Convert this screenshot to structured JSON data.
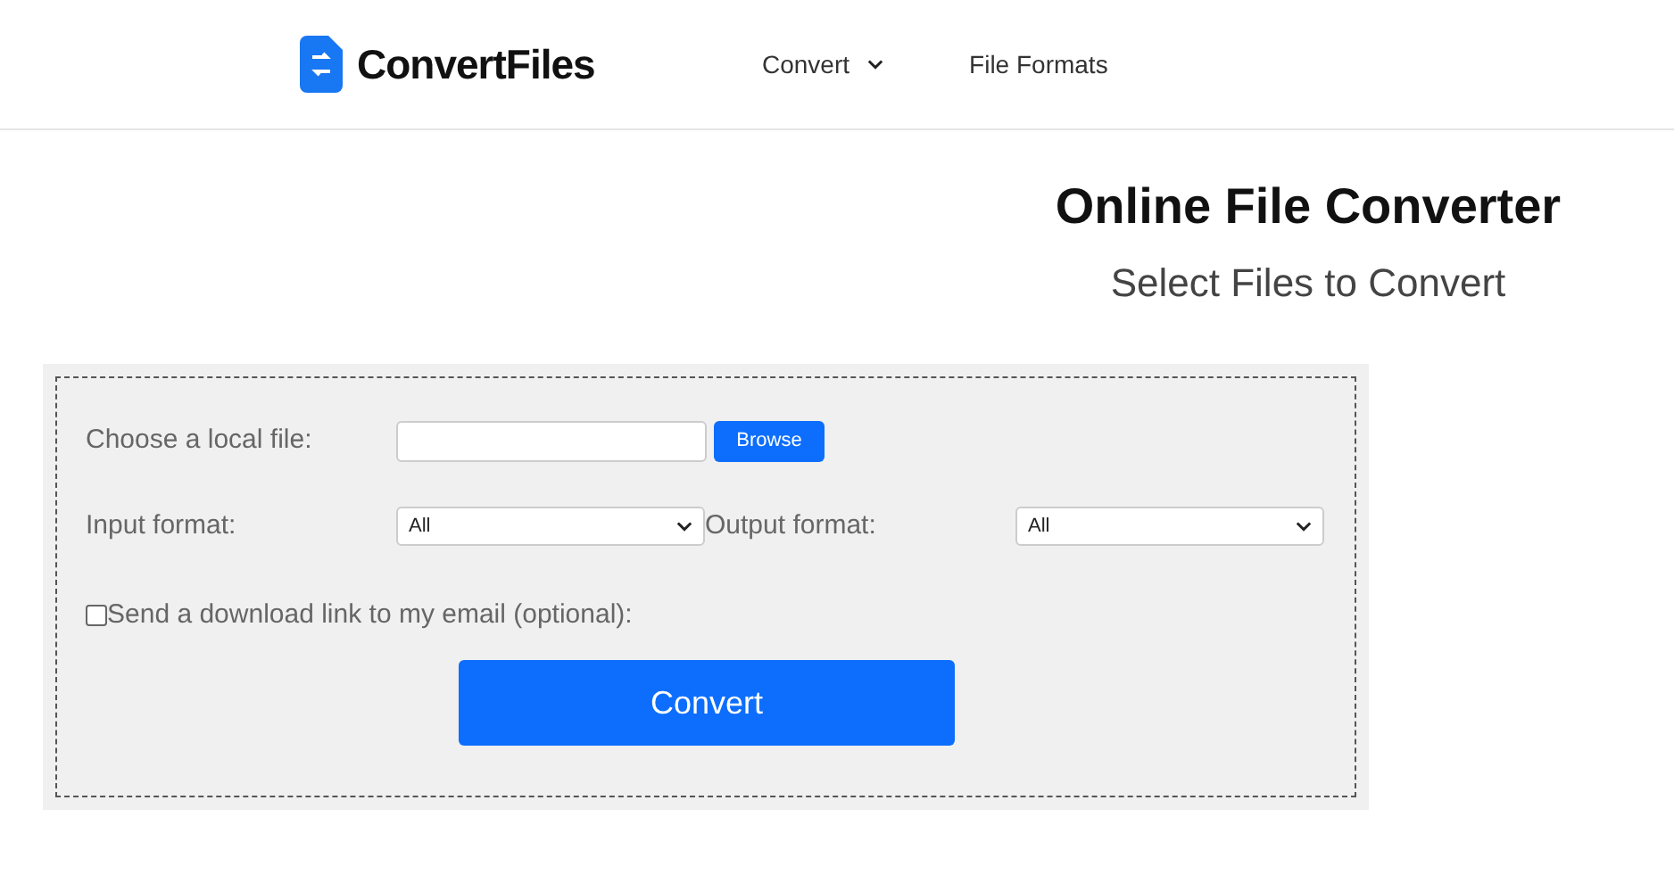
{
  "header": {
    "logo": "ConvertFiles",
    "nav": [
      {
        "label": "Convert",
        "kind": "dropdown"
      },
      {
        "label": "File Formats",
        "kind": "link"
      }
    ]
  },
  "hero": {
    "title": "Online File Converter",
    "subtitle": "Select Files to Convert"
  },
  "form": {
    "file_label": "Choose a local file:",
    "browse_button": "Browse",
    "input_format": {
      "label": "Input format:",
      "value": "All"
    },
    "output_format": {
      "label": "Output format:",
      "value": "All"
    },
    "email_option": {
      "label": "Send a download link to my email (optional):",
      "checked": false
    },
    "convert_button": "Convert"
  }
}
